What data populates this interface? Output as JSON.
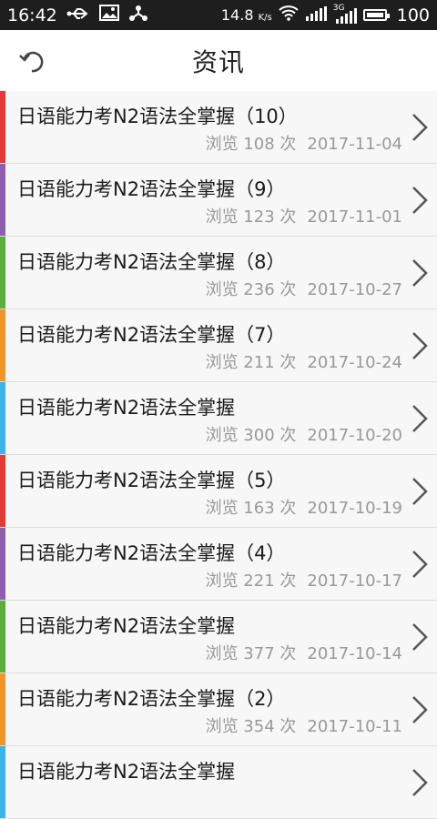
{
  "status_bar": {
    "time": "16:42",
    "speed": "14.8",
    "speed_unit": "K/s",
    "network": "3G",
    "battery": "100"
  },
  "header": {
    "title": "资讯"
  },
  "colors": {
    "red": "#e53935",
    "purple": "#8e5fb0",
    "green": "#5cad3e",
    "orange": "#f0952a",
    "blue": "#3ab4ea"
  },
  "items": [
    {
      "title": "日语能力考N2语法全掌握（10）",
      "views": "浏览 108 次",
      "date": "2017-11-04",
      "accent": "#e53935"
    },
    {
      "title": "日语能力考N2语法全掌握（9）",
      "views": "浏览 123 次",
      "date": "2017-11-01",
      "accent": "#8e5fb0"
    },
    {
      "title": "日语能力考N2语法全掌握（8）",
      "views": "浏览 236 次",
      "date": "2017-10-27",
      "accent": "#5cad3e"
    },
    {
      "title": "日语能力考N2语法全掌握（7）",
      "views": "浏览 211 次",
      "date": "2017-10-24",
      "accent": "#f0952a"
    },
    {
      "title": "日语能力考N2语法全掌握",
      "views": "浏览 300 次",
      "date": "2017-10-20",
      "accent": "#3ab4ea"
    },
    {
      "title": "日语能力考N2语法全掌握（5）",
      "views": "浏览 163 次",
      "date": "2017-10-19",
      "accent": "#e53935"
    },
    {
      "title": "日语能力考N2语法全掌握（4）",
      "views": "浏览 221 次",
      "date": "2017-10-17",
      "accent": "#8e5fb0"
    },
    {
      "title": "日语能力考N2语法全掌握",
      "views": "浏览 377 次",
      "date": "2017-10-14",
      "accent": "#5cad3e"
    },
    {
      "title": "日语能力考N2语法全掌握（2）",
      "views": "浏览 354 次",
      "date": "2017-10-11",
      "accent": "#f0952a"
    },
    {
      "title": "日语能力考N2语法全掌握",
      "views": "",
      "date": "",
      "accent": "#3ab4ea"
    }
  ]
}
